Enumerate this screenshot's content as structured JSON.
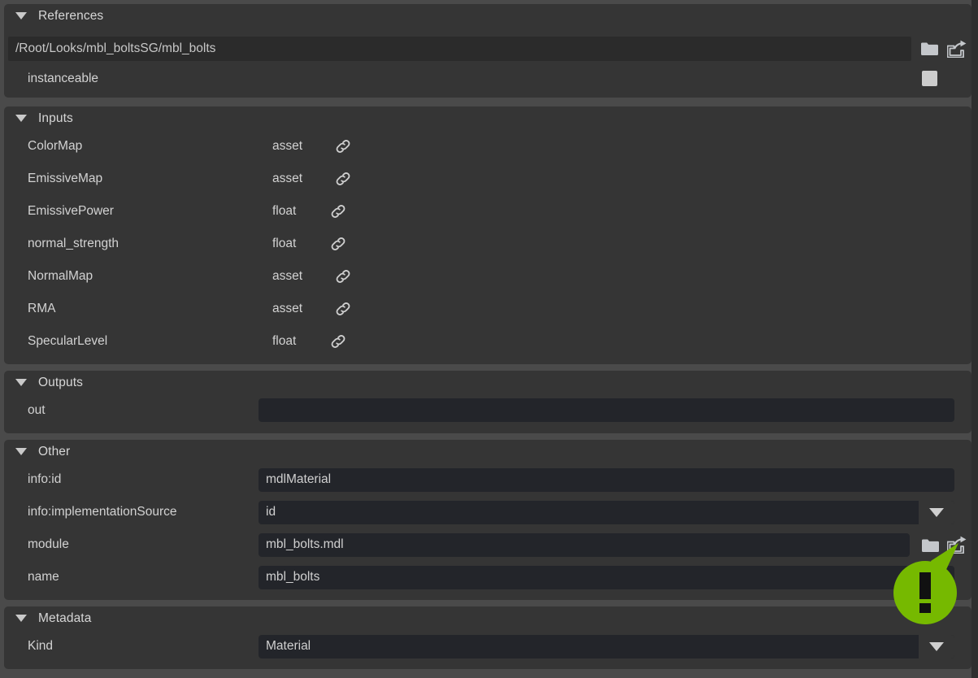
{
  "sections": {
    "references": {
      "title": "References",
      "caret_icon": "caret-down-icon",
      "path_value": "/Root/Looks/mbl_boltsSG/mbl_bolts",
      "folder_icon": "folder-icon",
      "open_external_icon": "open-external-icon",
      "instanceable_label": "instanceable",
      "instanceable_checked": true
    },
    "inputs": {
      "title": "Inputs",
      "caret_icon": "caret-down-icon",
      "rows": [
        {
          "name": "ColorMap",
          "type": "asset",
          "link_icon": "chain-link-icon"
        },
        {
          "name": "EmissiveMap",
          "type": "asset",
          "link_icon": "chain-link-icon"
        },
        {
          "name": "EmissivePower",
          "type": "float",
          "link_icon": "chain-link-icon"
        },
        {
          "name": "normal_strength",
          "type": "float",
          "link_icon": "chain-link-icon"
        },
        {
          "name": "NormalMap",
          "type": "asset",
          "link_icon": "chain-link-icon"
        },
        {
          "name": "RMA",
          "type": "asset",
          "link_icon": "chain-link-icon"
        },
        {
          "name": "SpecularLevel",
          "type": "float",
          "link_icon": "chain-link-icon"
        }
      ]
    },
    "outputs": {
      "title": "Outputs",
      "caret_icon": "caret-down-icon",
      "rows": [
        {
          "name": "out",
          "value": ""
        }
      ]
    },
    "other": {
      "title": "Other",
      "caret_icon": "caret-down-icon",
      "rows": [
        {
          "name": "info:id",
          "value": "mdlMaterial",
          "kind": "text"
        },
        {
          "name": "info:implementationSource",
          "value": "id",
          "kind": "dropdown",
          "arrow_icon": "chevron-down-icon"
        },
        {
          "name": "module",
          "value": "mbl_bolts.mdl",
          "kind": "text-with-buttons",
          "folder_icon": "folder-icon",
          "open_external_icon": "open-external-icon"
        },
        {
          "name": "name",
          "value": "mbl_bolts",
          "kind": "text"
        }
      ]
    },
    "metadata": {
      "title": "Metadata",
      "caret_icon": "caret-down-icon",
      "rows": [
        {
          "name": "Kind",
          "value": "Material",
          "kind": "dropdown",
          "arrow_icon": "chevron-down-icon"
        }
      ]
    }
  },
  "annotation": {
    "icon": "exclamation-callout-icon",
    "mark": "!",
    "color": "#76b900",
    "points_to": "open-external-icon"
  },
  "theme": {
    "page_background": "#4a4a4a",
    "panel_background": "#353535",
    "field_background": "#23252a",
    "text_primary": "#d2d2d2",
    "accent_green": "#76b900"
  }
}
